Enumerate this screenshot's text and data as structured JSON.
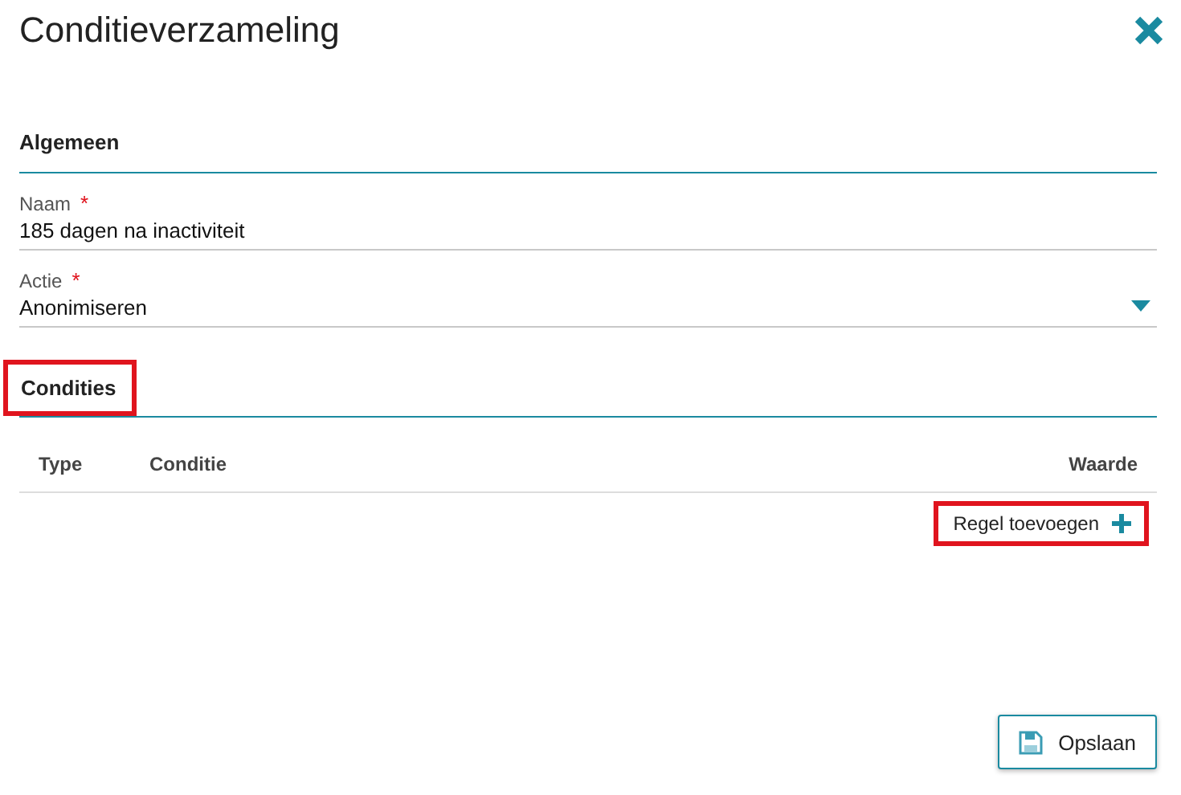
{
  "dialog": {
    "title": "Conditieverzameling"
  },
  "sections": [
    {
      "title": "Algemeen",
      "highlighted": false,
      "fields": [
        {
          "kind": "text",
          "label": "Naam",
          "required_mark": "*",
          "value": "185 dagen na inactiviteit"
        },
        {
          "kind": "select",
          "label": "Actie",
          "required_mark": "*",
          "value": "Anonimiseren"
        }
      ]
    },
    {
      "title": "Condities",
      "highlighted": true,
      "table": {
        "columns": [
          "Type",
          "Conditie",
          "Waarde"
        ]
      },
      "add_button": {
        "label": "Regel toevoegen",
        "highlighted": true
      }
    }
  ],
  "footer": {
    "save_button": "Opslaan"
  }
}
